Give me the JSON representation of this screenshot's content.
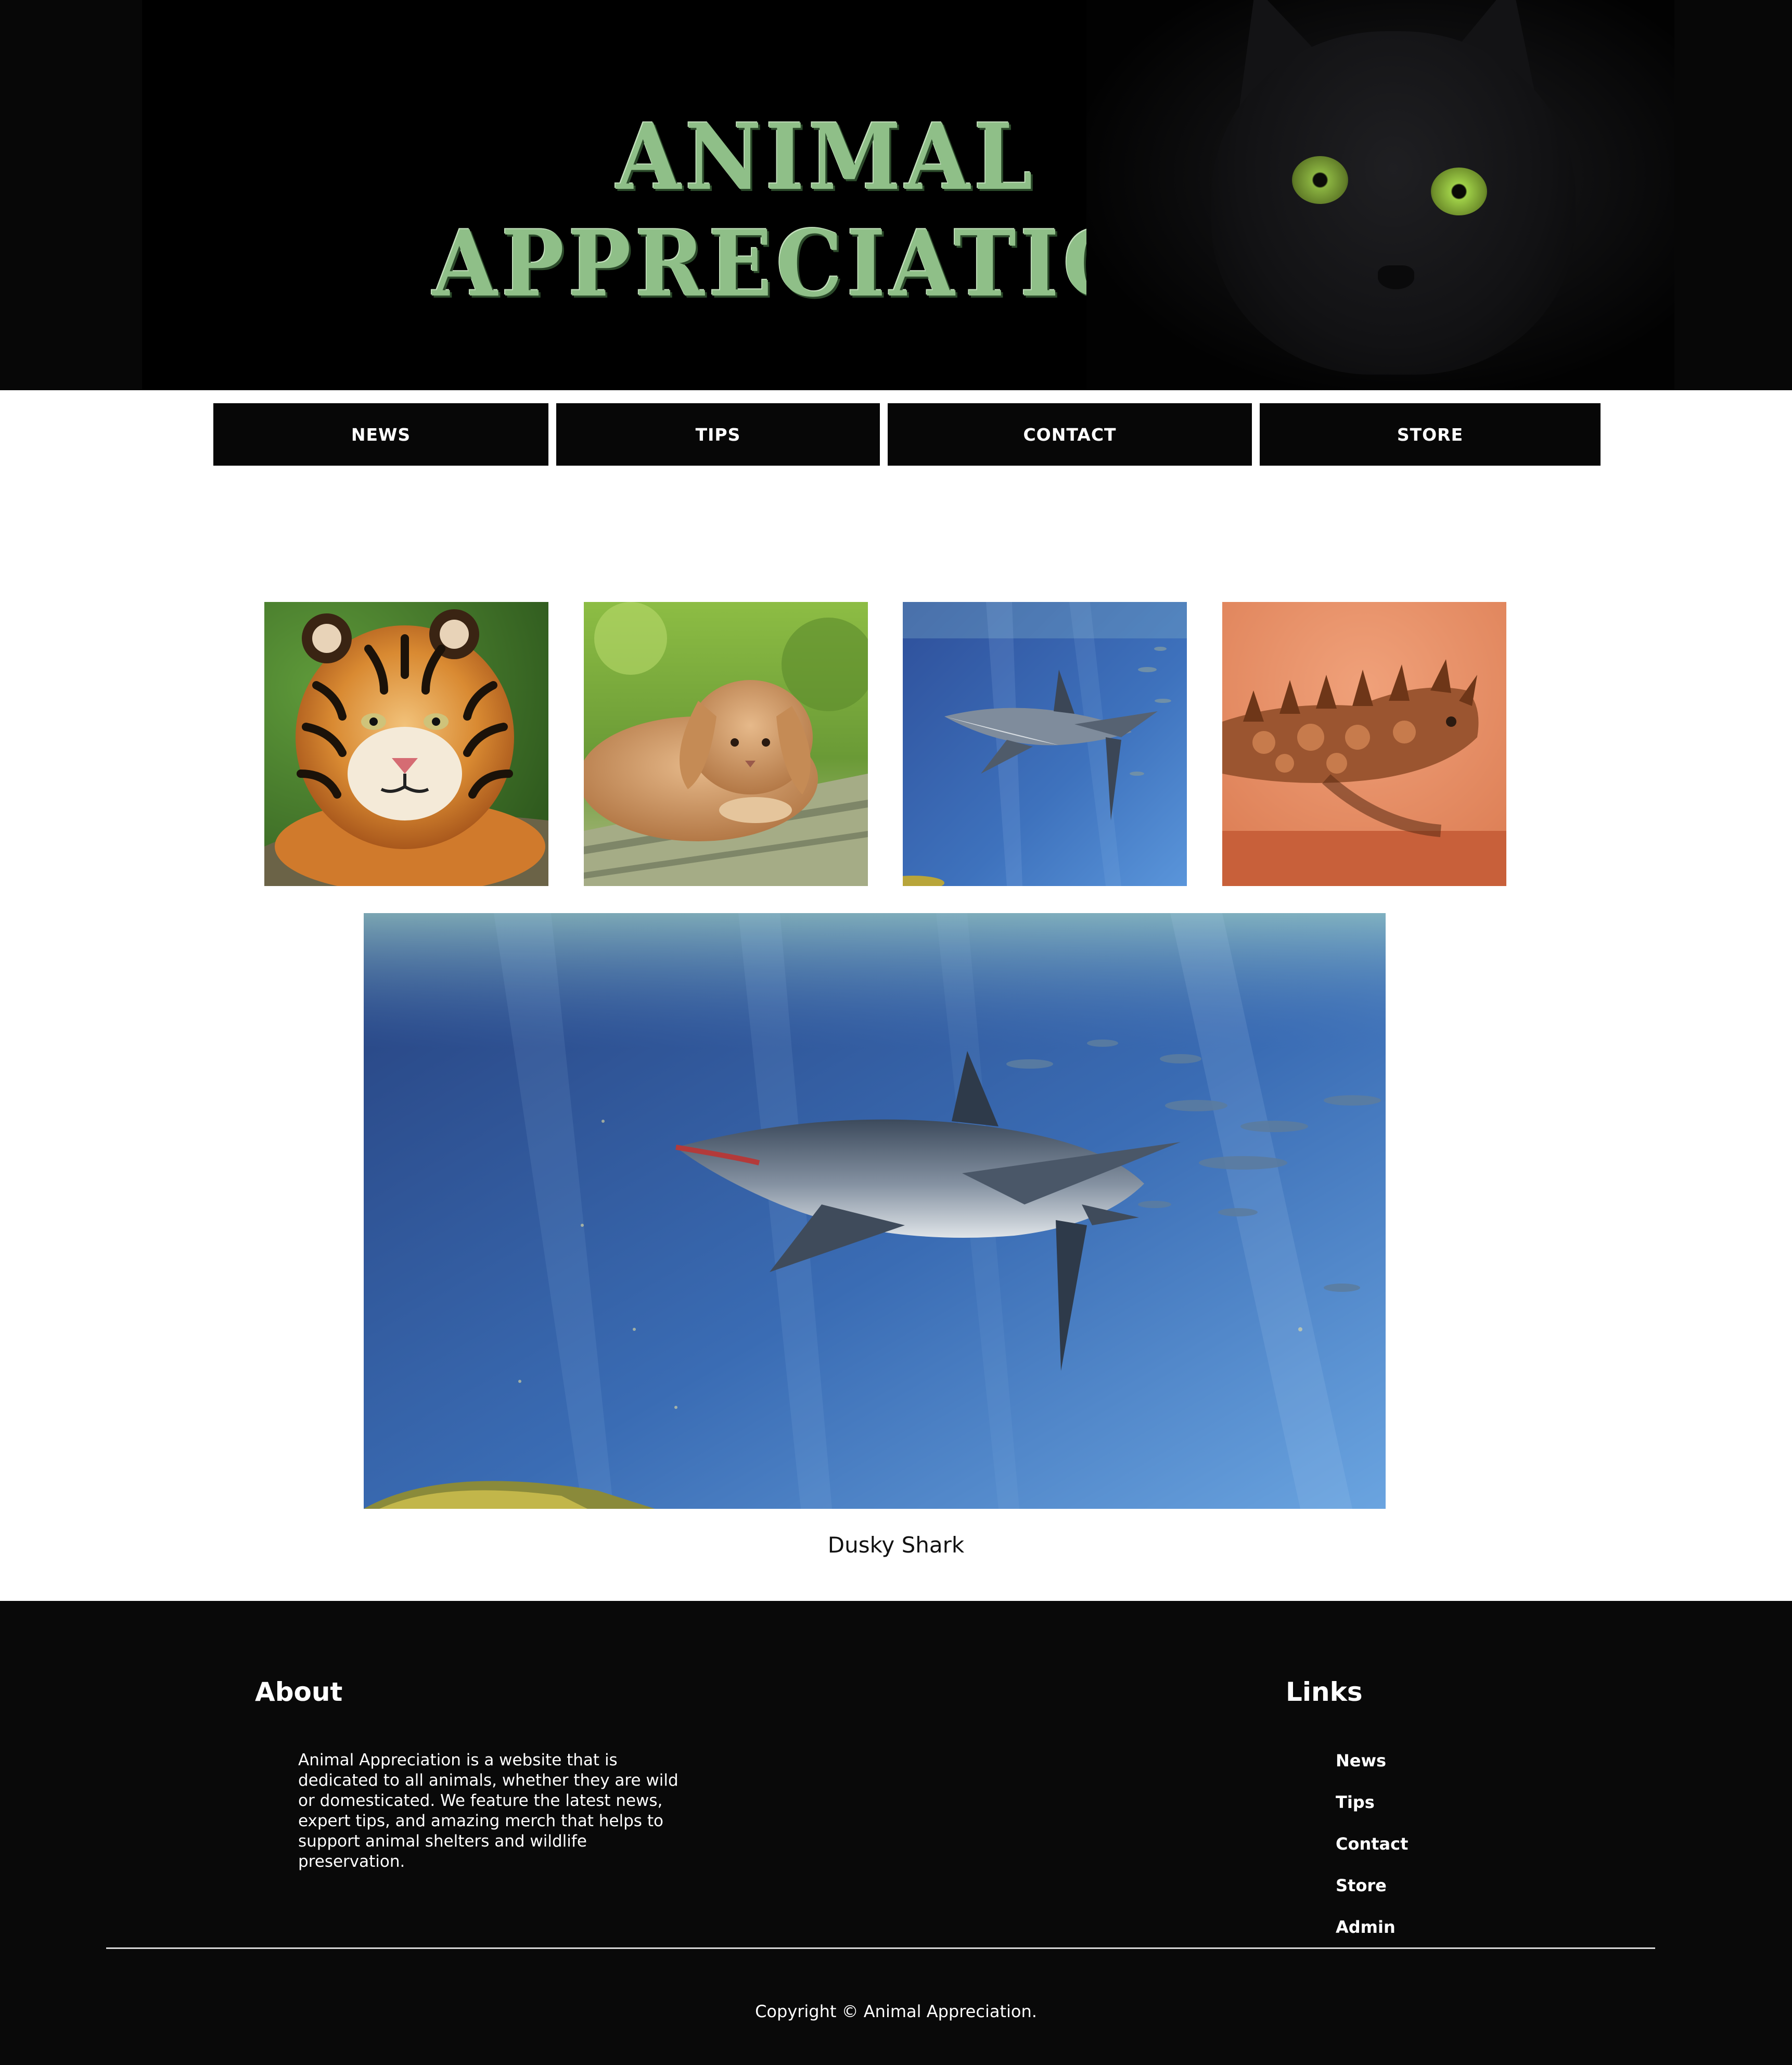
{
  "header": {
    "logo_line1": "ANIMAL",
    "logo_line2": "APPRECIATION",
    "logo_color": "#8fbf88"
  },
  "nav": {
    "items": [
      {
        "label": "NEWS"
      },
      {
        "label": "TIPS"
      },
      {
        "label": "CONTACT"
      },
      {
        "label": "STORE"
      }
    ]
  },
  "gallery": {
    "thumbnails": [
      {
        "subject": "tiger"
      },
      {
        "subject": "rabbit"
      },
      {
        "subject": "shark"
      },
      {
        "subject": "thorny-devil-lizard"
      }
    ],
    "featured_caption": "Dusky Shark"
  },
  "footer": {
    "about_heading": "About",
    "about_text": "Animal Appreciation is a website that is dedicated to all animals, whether they are wild or domesticated. We feature the latest news, expert tips, and amazing merch that helps to support animal shelters and wildlife preservation.",
    "links_heading": "Links",
    "links": [
      {
        "label": "News"
      },
      {
        "label": "Tips"
      },
      {
        "label": "Contact"
      },
      {
        "label": "Store"
      },
      {
        "label": "Admin"
      }
    ],
    "copyright": "Copyright © Animal Appreciation."
  },
  "colors": {
    "banner_bg": "#000000",
    "nav_bg": "#070707",
    "footer_bg": "#090909",
    "text_light": "#ffffff"
  }
}
